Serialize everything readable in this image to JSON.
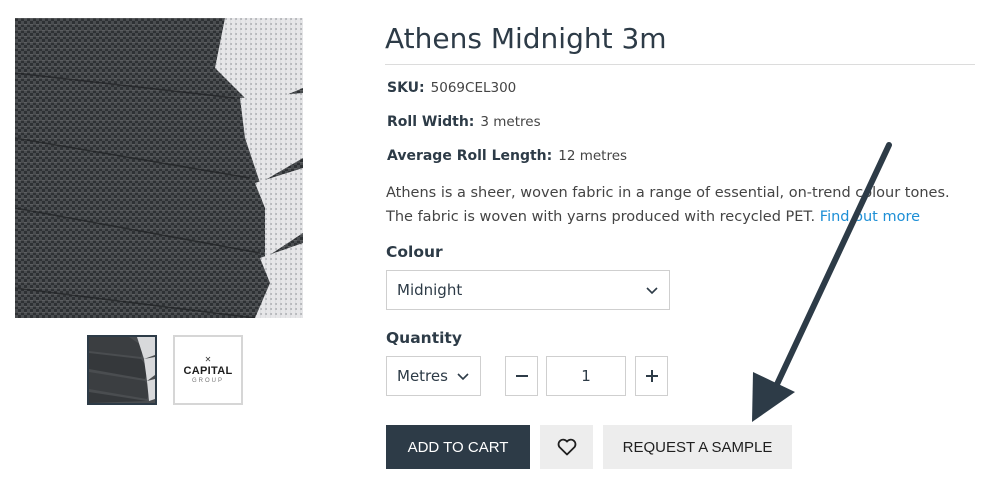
{
  "product": {
    "title": "Athens Midnight 3m",
    "sku_label": "SKU:",
    "sku_value": "5069CEL300",
    "roll_width_label": "Roll Width:",
    "roll_width_value": "3 metres",
    "roll_length_label": "Average Roll Length:",
    "roll_length_value": "12 metres",
    "description_line1": "Athens is a sheer, woven fabric in a range of essential, on-trend colour tones.",
    "description_line2": "The fabric is woven with yarns produced with recycled PET.",
    "find_out_more": "Find out more"
  },
  "gallery": {
    "main_image_icon": "pleated-blind-fabric-image",
    "thumbnails": [
      {
        "icon": "pleated-blind-fabric-thumbnail",
        "active": true
      },
      {
        "icon": "capital-brand-logo",
        "active": false,
        "brand_text": "CAPITAL",
        "brand_sub": "GROUP"
      }
    ]
  },
  "colour": {
    "label": "Colour",
    "selected": "Midnight"
  },
  "quantity": {
    "label": "Quantity",
    "unit_selected": "Metres",
    "value": "1",
    "minus": "−",
    "plus": "+"
  },
  "actions": {
    "add_to_cart": "ADD TO CART",
    "wishlist_icon": "heart-icon",
    "request_sample": "REQUEST A SAMPLE"
  },
  "annotation": {
    "arrow_color": "#2d3b47"
  },
  "colors": {
    "primary": "#2d3b47",
    "link": "#1d8fd6",
    "button_light": "#ededed"
  }
}
